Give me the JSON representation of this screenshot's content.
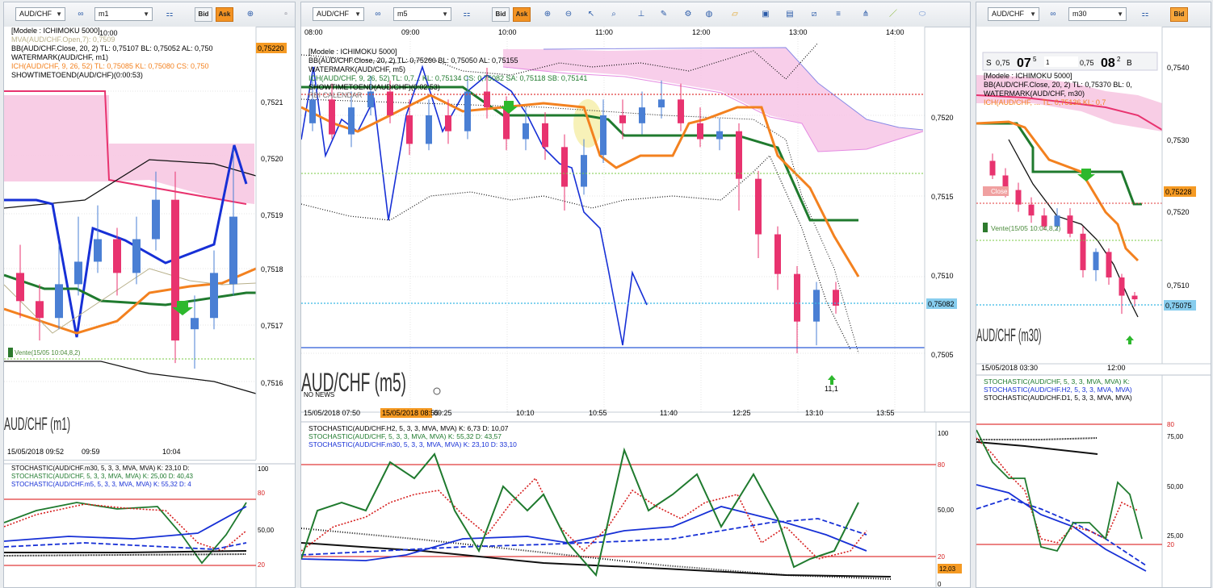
{
  "colors": {
    "pink": "#f2b8d8",
    "red": "#e8336f",
    "blue": "#2b5ad7",
    "green": "#1f7a2e",
    "orange": "#f3811f",
    "price_box": "#f59a23",
    "cur_box": "#87cdee"
  },
  "left": {
    "toolbar": {
      "symbol": "AUD/CHF",
      "timeframe": "m1",
      "bid": "Bid",
      "ask": "Ask"
    },
    "time_top": "10:00",
    "legend": [
      "[Modele : ICHIMOKU 5000]",
      "MVA(AUD/CHF.Open,7): 0,7509",
      "BB(AUD/CHF.Close, 20, 2)  TL: 0,75107  BL: 0,75052  AL: 0,750",
      "WATERMARK(AUD/CHF, m1)",
      "ICH(AUD/CHF, 9, 26, 52)  TL: 0,75085  KL: 0,75080  CS: 0,750",
      "SHOWTIMETOEND(AUD/CHF)(0:00:53)"
    ],
    "price_labels": [
      "0,7521",
      "0,7520",
      "0,7519",
      "0,7518",
      "0,7517",
      "0,7516"
    ],
    "price_box": "0,75220",
    "vente": "Vente(15/05 10:04,8,2)",
    "watermark": "AUD/CHF (m1)",
    "time_axis": [
      "15/05/2018 09:52",
      "09:59",
      "10:04"
    ],
    "stoch_legend": [
      "STOCHASTIC(AUD/CHF.m30, 5, 3, 3, MVA, MVA)  K: 23,10  D:",
      "STOCHASTIC(AUD/CHF, 5, 3, 3, MVA, MVA)  K: 25,00  D: 40,43",
      "STOCHASTIC(AUD/CHF.m5, 5, 3, 3, MVA, MVA)  K: 55,32  D: 4"
    ],
    "stoch_labels": [
      "100",
      "80",
      "50,00",
      "20"
    ]
  },
  "mid": {
    "toolbar": {
      "symbol": "AUD/CHF",
      "timeframe": "m5",
      "bid": "Bid",
      "ask": "Ask"
    },
    "time_top": [
      "08:00",
      "09:00",
      "10:00",
      "11:00",
      "12:00",
      "13:00",
      "14:00"
    ],
    "legend": [
      "[Modele : ICHIMOKU 5000]",
      "BB(AUD/CHF.Close, 20, 2)  TL: 0,75260  BL: 0,75050  AL: 0,75155",
      "WATERMARK(AUD/CHF, m5)",
      "ICH(AUD/CHF, 9, 26, 52)  TL: 0,7...  KL: 0,75134  CS: 0,75082  SA: 0,75118  SB: 0,75141",
      "SHOWTIMETOEND(AUD/CHF)(0:02:53)",
      "RBI CALENDAR"
    ],
    "price_labels": [
      "0,7520",
      "0,7515",
      "0,7510",
      "0,7505"
    ],
    "price_box": "0,75082",
    "watermark": "AUD/CHF (m5)",
    "no_news": "NO NEWS",
    "arrow_label": "11,1",
    "time_axis": [
      "15/05/2018 07:50",
      "15/05/2018 08:55",
      "09:25",
      "10:10",
      "10:55",
      "11:40",
      "12:25",
      "13:10",
      "13:55"
    ],
    "stoch_legend": [
      "STOCHASTIC(AUD/CHF.H2, 5, 3, 3, MVA, MVA)  K: 6,73  D: 10,07",
      "STOCHASTIC(AUD/CHF, 5, 3, 3, MVA, MVA)  K: 55,32  D: 43,57",
      "STOCHASTIC(AUD/CHF.m30, 5, 3, 3, MVA, MVA)  K: 23,10  D: 33,10"
    ],
    "stoch_labels": [
      "100",
      "80",
      "50,00",
      "20",
      "0"
    ],
    "stoch_box": "12,03"
  },
  "right": {
    "toolbar": {
      "symbol": "AUD/CHF",
      "timeframe": "m30",
      "bid": "Bid"
    },
    "quote": {
      "s": "S",
      "bid_small": "0,75",
      "bid_big": "07",
      "bid_sup": "5",
      "spread": "1",
      "ask_small": "0,75",
      "ask_big": "08",
      "ask_sup": "2",
      "b": "B"
    },
    "legend": [
      "[Modele : ICHIMOKU 5000]",
      "BB(AUD/CHF.Close, 20, 2)  TL: 0,75370  BL: 0,",
      "WATERMARK(AUD/CHF, m30)",
      "ICH(AUD/CHF, ...  TL: 0,75136  KL: 0,7"
    ],
    "price_labels": [
      "0,7540",
      "0,7530",
      "0,7520",
      "0,7510"
    ],
    "price_box_orange": "0,75228",
    "price_box_blue": "0,75075",
    "close_label": "Close",
    "vente": "Vente(15/05 10:04,8,2)",
    "watermark": "AUD/CHF (m30)",
    "time_axis": [
      "15/05/2018 03:30",
      "12:00"
    ],
    "stoch_legend": [
      "STOCHASTIC(AUD/CHF, 5, 3, 3, MVA, MVA)  K:",
      "STOCHASTIC(AUD/CHF.H2, 5, 3, 3, MVA, MVA)",
      "STOCHASTIC(AUD/CHF.D1, 5, 3, 3, MVA, MVA)"
    ],
    "stoch_labels": [
      "80",
      "75,00",
      "50,00",
      "25,00",
      "20"
    ]
  },
  "chart_data": [
    {
      "type": "candlestick",
      "title": "AUD/CHF (m1)",
      "y_axis": [
        "0,7516",
        "0,7521"
      ],
      "last_price": "0,75220",
      "candles": [
        [
          0.7518,
          0.75175,
          0.75185,
          0.75172
        ],
        [
          0.75175,
          0.75172,
          0.75178,
          0.75168
        ],
        [
          0.75172,
          0.75178,
          0.75185,
          0.7517
        ],
        [
          0.75178,
          0.75182,
          0.7519,
          0.75176
        ],
        [
          0.75182,
          0.75186,
          0.75192,
          0.7518
        ],
        [
          0.75186,
          0.7518,
          0.75188,
          0.75176
        ],
        [
          0.7518,
          0.75186,
          0.7519,
          0.75178
        ],
        [
          0.75186,
          0.75193,
          0.75198,
          0.75184
        ],
        [
          0.75193,
          0.75168,
          0.75198,
          0.75164
        ],
        [
          0.7517,
          0.75172,
          0.75176,
          0.75163
        ],
        [
          0.75172,
          0.7518,
          0.75184,
          0.7517
        ],
        [
          0.75178,
          0.7519,
          0.75202,
          0.75176
        ]
      ]
    },
    {
      "type": "candlestick",
      "title": "AUD/CHF (m5)",
      "y_axis": [
        "0,7505",
        "0,7520"
      ],
      "last_price": "0,75082",
      "arrow_value": "11,1",
      "candles": [
        [
          0.75195,
          0.7521,
          0.75225,
          0.7519
        ],
        [
          0.7521,
          0.75188,
          0.7522,
          0.75185
        ],
        [
          0.75188,
          0.75205,
          0.75215,
          0.7518
        ],
        [
          0.75205,
          0.75215,
          0.75225,
          0.752
        ],
        [
          0.75215,
          0.752,
          0.75222,
          0.75195
        ],
        [
          0.752,
          0.75182,
          0.7521,
          0.75175
        ],
        [
          0.75182,
          0.752,
          0.7521,
          0.75178
        ],
        [
          0.752,
          0.7519,
          0.7521,
          0.75182
        ],
        [
          0.7519,
          0.75215,
          0.75225,
          0.75185
        ],
        [
          0.75215,
          0.75205,
          0.7523,
          0.75198
        ],
        [
          0.75205,
          0.75185,
          0.75212,
          0.75178
        ],
        [
          0.75185,
          0.75195,
          0.75205,
          0.75178
        ],
        [
          0.75195,
          0.7518,
          0.75202,
          0.75172
        ],
        [
          0.7518,
          0.75155,
          0.75188,
          0.7514
        ],
        [
          0.75155,
          0.75175,
          0.75185,
          0.7515
        ],
        [
          0.75175,
          0.752,
          0.7521,
          0.7517
        ],
        [
          0.752,
          0.75195,
          0.7521,
          0.75185
        ],
        [
          0.75195,
          0.75205,
          0.75215,
          0.75188
        ],
        [
          0.75205,
          0.7521,
          0.75222,
          0.75198
        ],
        [
          0.7521,
          0.75195,
          0.7522,
          0.7519
        ],
        [
          0.75195,
          0.75185,
          0.75205,
          0.7518
        ],
        [
          0.75185,
          0.7519,
          0.75198,
          0.75178
        ],
        [
          0.7519,
          0.7516,
          0.75195,
          0.7514
        ],
        [
          0.7516,
          0.75125,
          0.75165,
          0.7511
        ],
        [
          0.75125,
          0.751,
          0.7513,
          0.7509
        ],
        [
          0.751,
          0.7507,
          0.75105,
          0.7505
        ],
        [
          0.7507,
          0.7509,
          0.75095,
          0.75055
        ],
        [
          0.7509,
          0.7508,
          0.75095,
          0.75075
        ]
      ]
    },
    {
      "type": "candlestick",
      "title": "AUD/CHF (m30)",
      "y_axis": [
        "0,7510",
        "0,7540"
      ],
      "last_price": "0,75075",
      "candles": [
        [
          0.7527,
          0.7525,
          0.7528,
          0.75245
        ],
        [
          0.7525,
          0.7523,
          0.7526,
          0.7522
        ],
        [
          0.7523,
          0.7521,
          0.7524,
          0.752
        ],
        [
          0.7521,
          0.75195,
          0.7522,
          0.75185
        ],
        [
          0.75195,
          0.7518,
          0.75205,
          0.75175
        ],
        [
          0.7518,
          0.75195,
          0.75205,
          0.75175
        ],
        [
          0.75195,
          0.7517,
          0.75205,
          0.75165
        ],
        [
          0.7517,
          0.7512,
          0.7518,
          0.7511
        ],
        [
          0.7512,
          0.75145,
          0.7515,
          0.75105
        ],
        [
          0.75145,
          0.7511,
          0.7515,
          0.751
        ],
        [
          0.7511,
          0.75085,
          0.75115,
          0.7506
        ],
        [
          0.75085,
          0.7508,
          0.7509,
          0.7507
        ]
      ]
    },
    {
      "type": "line",
      "title": "STOCHASTIC m5 panel",
      "ylim": [
        0,
        100
      ],
      "series": [
        {
          "values": [
            30,
            55,
            75,
            62,
            85,
            40,
            70,
            35,
            65,
            30,
            55,
            70,
            40,
            20,
            50,
            75,
            30,
            60,
            45,
            20,
            55,
            35,
            60
          ]
        },
        {
          "values": [
            28,
            29,
            30,
            35,
            38,
            42,
            45,
            44,
            42,
            38,
            35,
            32,
            30,
            28,
            30,
            32,
            34,
            36
          ]
        }
      ]
    }
  ]
}
